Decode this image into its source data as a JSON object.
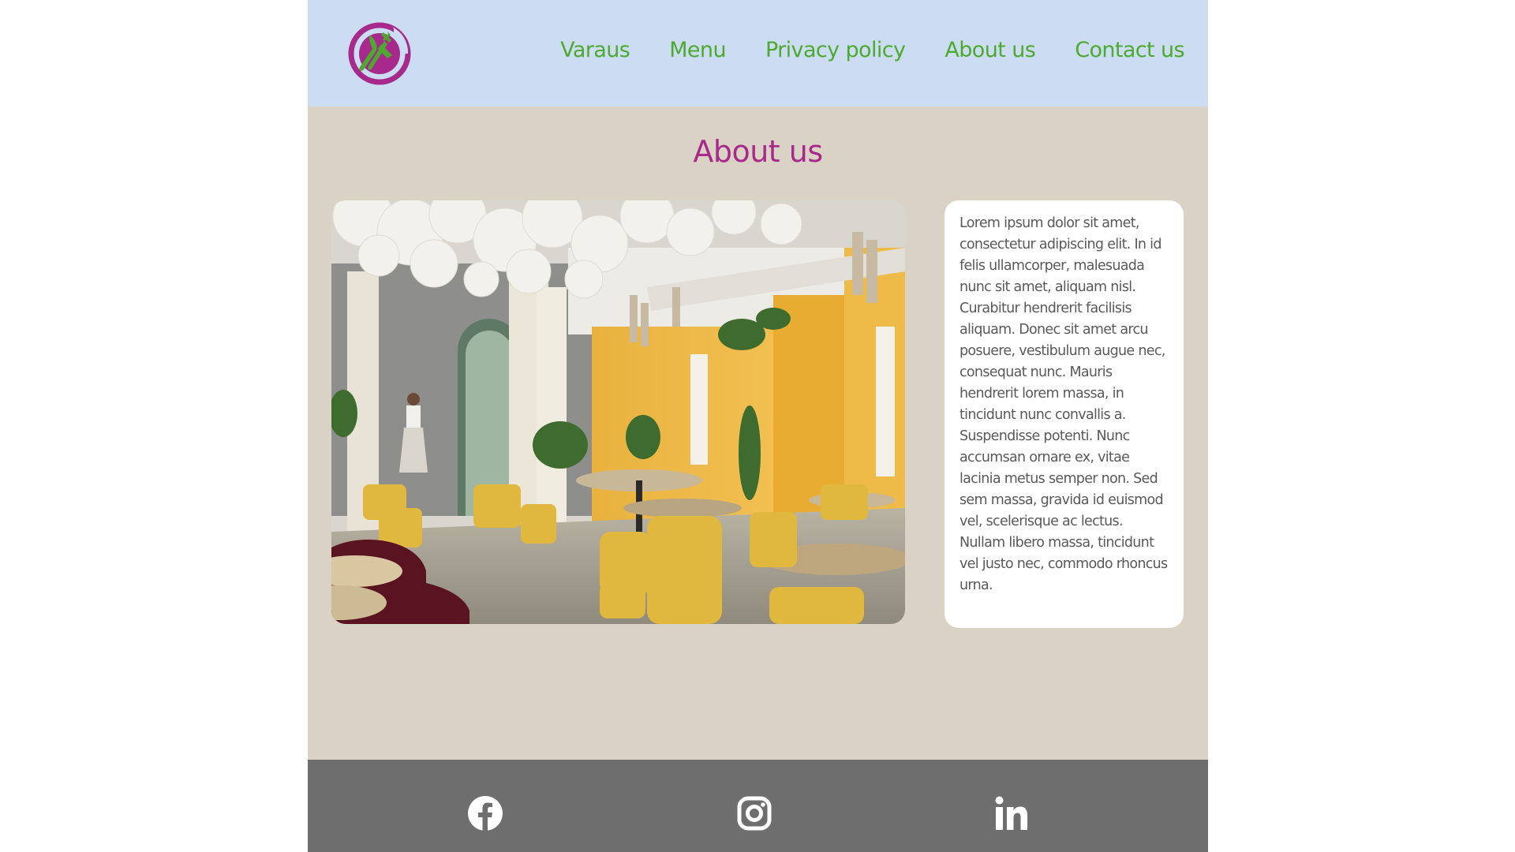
{
  "header": {
    "logo_icon": "fork-knife-plate-logo-icon",
    "nav": [
      {
        "label": "Varaus"
      },
      {
        "label": "Menu"
      },
      {
        "label": "Privacy policy"
      },
      {
        "label": "About us"
      },
      {
        "label": "Contact us"
      }
    ]
  },
  "main": {
    "title": "About us",
    "photo_icon": "restaurant-interior-photo",
    "text": "Lorem ipsum dolor sit amet, consectetur adipiscing elit. In id felis ullamcorper, malesuada nunc sit amet, aliquam nisl. Curabitur hendrerit facilisis aliquam. Donec sit amet arcu posuere, vestibulum augue nec, consequat nunc. Mauris hendrerit lorem massa, in tincidunt nunc convallis a. Suspendisse potenti. Nunc accumsan ornare ex, vitae lacinia metus semper non. Sed sem massa, gravida id euismod vel, scelerisque ac lectus. Nullam libero massa, tincidunt vel justo nec, commodo rhoncus urna."
  },
  "footer": {
    "social": [
      {
        "icon": "facebook-icon"
      },
      {
        "icon": "instagram-icon"
      },
      {
        "icon": "linkedin-icon"
      }
    ]
  },
  "colors": {
    "header_bg": "#ccdcf2",
    "page_bg": "#dbd2c6",
    "nav_text": "#4caa2e",
    "title": "#a8298c",
    "footer_bg": "#6e6e6e",
    "card_bg": "#ffffff",
    "body_text": "#595959"
  }
}
